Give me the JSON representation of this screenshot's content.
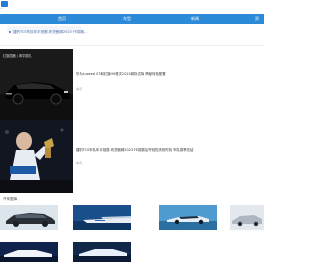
{
  "header": {
    "logo_word": "—"
  },
  "nav": {
    "items": [
      {
        "label": "首页"
      },
      {
        "label": "车型"
      },
      {
        "label": "新闻"
      },
      {
        "label": "资"
      }
    ]
  },
  "ticker": {
    "headline": "捷豹TCS车队年平冠赛-布茨鲍姆2023 FE锦赛..."
  },
  "cards": [
    {
      "image_caption": "红旗国器 | 尊享国礼",
      "text": "华为Luxeed S7和红旗H9首次2023城际试驾 揭秘特色配置",
      "meta": "车讯"
    },
    {
      "image_caption": "",
      "text": "捷豹TCS车队年平冠赛-布茨鲍姆2023 FE锦赛后夺冠的庆祝时刻 车队赛季总结",
      "meta": "车讯"
    }
  ],
  "gallery": {
    "title": "汽车图库"
  }
}
